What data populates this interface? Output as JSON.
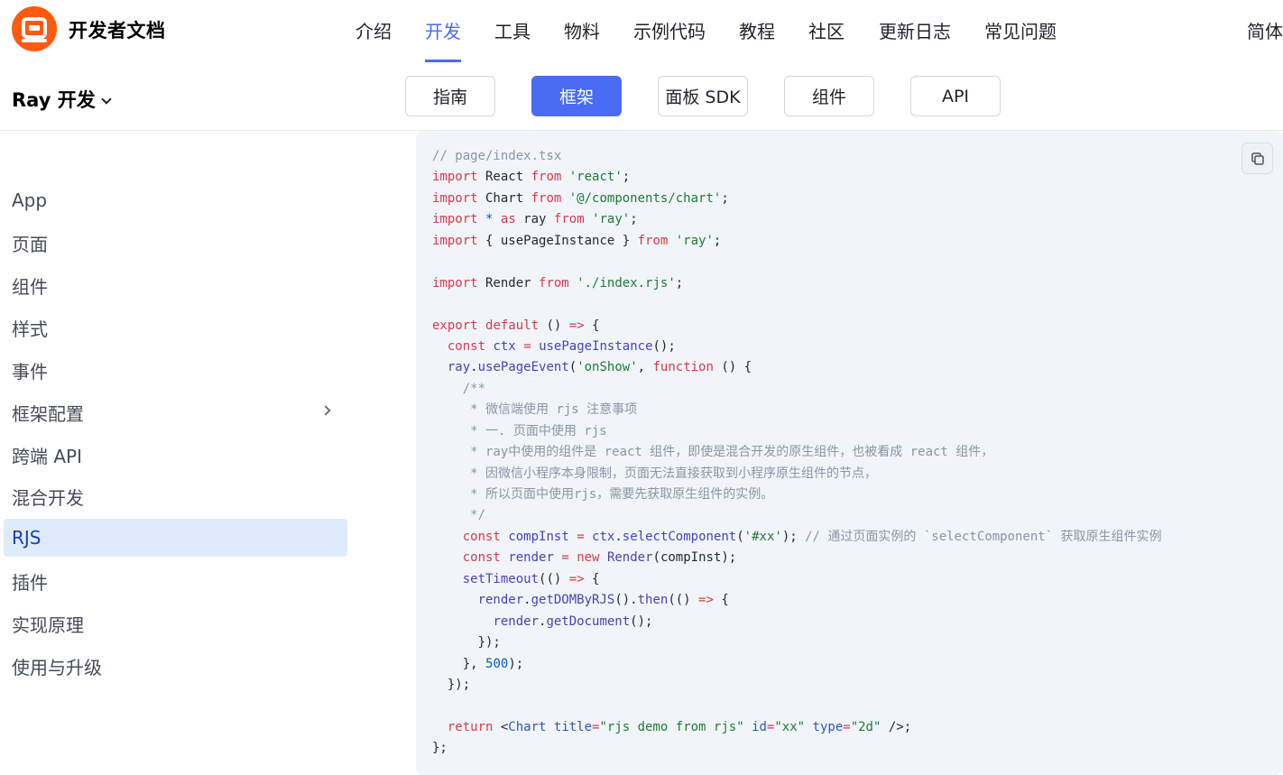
{
  "topbar": {
    "brand": "开发者文档",
    "nav": [
      "介绍",
      "开发",
      "工具",
      "物料",
      "示例代码",
      "教程",
      "社区",
      "更新日志",
      "常见问题"
    ],
    "active_nav": "开发",
    "lang": "简体"
  },
  "subheader": {
    "product": "Ray 开发",
    "tabs": [
      "指南",
      "框架",
      "面板 SDK",
      "组件",
      "API"
    ],
    "active_tab": "框架"
  },
  "sidebar": {
    "items": [
      "App",
      "页面",
      "组件",
      "样式",
      "事件",
      "框架配置",
      "跨端 API",
      "混合开发",
      "RJS",
      "插件",
      "实现原理",
      "使用与升级"
    ],
    "active": "RJS"
  },
  "code": {
    "copy_icon": "copy-icon",
    "lines": [
      [
        [
          "c",
          "// page/index.tsx"
        ]
      ],
      [
        [
          "k",
          "import"
        ],
        [
          "p",
          " React "
        ],
        [
          "k",
          "from"
        ],
        [
          "p",
          " "
        ],
        [
          "s",
          "'react'"
        ],
        [
          "p",
          ";"
        ]
      ],
      [
        [
          "k",
          "import"
        ],
        [
          "p",
          " Chart "
        ],
        [
          "k",
          "from"
        ],
        [
          "p",
          " "
        ],
        [
          "s",
          "'@/components/chart'"
        ],
        [
          "p",
          ";"
        ]
      ],
      [
        [
          "k",
          "import"
        ],
        [
          "p",
          " "
        ],
        [
          "n",
          "*"
        ],
        [
          "p",
          " "
        ],
        [
          "k",
          "as"
        ],
        [
          "p",
          " ray "
        ],
        [
          "k",
          "from"
        ],
        [
          "p",
          " "
        ],
        [
          "s",
          "'ray'"
        ],
        [
          "p",
          ";"
        ]
      ],
      [
        [
          "k",
          "import"
        ],
        [
          "p",
          " { usePageInstance } "
        ],
        [
          "k",
          "from"
        ],
        [
          "p",
          " "
        ],
        [
          "s",
          "'ray'"
        ],
        [
          "p",
          ";"
        ]
      ],
      [],
      [
        [
          "k",
          "import"
        ],
        [
          "p",
          " Render "
        ],
        [
          "k",
          "from"
        ],
        [
          "p",
          " "
        ],
        [
          "s",
          "'./index.rjs'"
        ],
        [
          "p",
          ";"
        ]
      ],
      [],
      [
        [
          "k",
          "export"
        ],
        [
          "p",
          " "
        ],
        [
          "k",
          "default"
        ],
        [
          "p",
          " () "
        ],
        [
          "k",
          "=>"
        ],
        [
          "p",
          " {"
        ]
      ],
      [
        [
          "p",
          "  "
        ],
        [
          "k",
          "const"
        ],
        [
          "p",
          " "
        ],
        [
          "f",
          "ctx"
        ],
        [
          "p",
          " "
        ],
        [
          "k",
          "="
        ],
        [
          "p",
          " "
        ],
        [
          "f",
          "usePageInstance"
        ],
        [
          "p",
          "();"
        ]
      ],
      [
        [
          "p",
          "  "
        ],
        [
          "f",
          "ray"
        ],
        [
          "p",
          "."
        ],
        [
          "f",
          "usePageEvent"
        ],
        [
          "p",
          "("
        ],
        [
          "s",
          "'onShow'"
        ],
        [
          "p",
          ", "
        ],
        [
          "k",
          "function"
        ],
        [
          "p",
          " () {"
        ]
      ],
      [
        [
          "c",
          "    /**"
        ]
      ],
      [
        [
          "c",
          "     * 微信端使用 rjs 注意事项"
        ]
      ],
      [
        [
          "c",
          "     * 一. 页面中使用 rjs"
        ]
      ],
      [
        [
          "c",
          "     * ray中使用的组件是 react 组件，即使是混合开发的原生组件，也被看成 react 组件，"
        ]
      ],
      [
        [
          "c",
          "     * 因微信小程序本身限制，页面无法直接获取到小程序原生组件的节点，"
        ]
      ],
      [
        [
          "c",
          "     * 所以页面中使用rjs，需要先获取原生组件的实例。"
        ]
      ],
      [
        [
          "c",
          "     */"
        ]
      ],
      [
        [
          "p",
          "    "
        ],
        [
          "k",
          "const"
        ],
        [
          "p",
          " "
        ],
        [
          "f",
          "compInst"
        ],
        [
          "p",
          " "
        ],
        [
          "k",
          "="
        ],
        [
          "p",
          " "
        ],
        [
          "f",
          "ctx"
        ],
        [
          "p",
          "."
        ],
        [
          "f",
          "selectComponent"
        ],
        [
          "p",
          "("
        ],
        [
          "s",
          "'#xx'"
        ],
        [
          "p",
          "); "
        ],
        [
          "c",
          "// 通过页面实例的 `selectComponent` 获取原生组件实例"
        ]
      ],
      [
        [
          "p",
          "    "
        ],
        [
          "k",
          "const"
        ],
        [
          "p",
          " "
        ],
        [
          "f",
          "render"
        ],
        [
          "p",
          " "
        ],
        [
          "k",
          "="
        ],
        [
          "p",
          " "
        ],
        [
          "k",
          "new"
        ],
        [
          "p",
          " "
        ],
        [
          "f",
          "Render"
        ],
        [
          "p",
          "(compInst);"
        ]
      ],
      [
        [
          "p",
          "    "
        ],
        [
          "f",
          "setTimeout"
        ],
        [
          "p",
          "(() "
        ],
        [
          "k",
          "=>"
        ],
        [
          "p",
          " {"
        ]
      ],
      [
        [
          "p",
          "      "
        ],
        [
          "f",
          "render"
        ],
        [
          "p",
          "."
        ],
        [
          "f",
          "getDOMByRJS"
        ],
        [
          "p",
          "()."
        ],
        [
          "f",
          "then"
        ],
        [
          "p",
          "(() "
        ],
        [
          "k",
          "=>"
        ],
        [
          "p",
          " {"
        ]
      ],
      [
        [
          "p",
          "        "
        ],
        [
          "f",
          "render"
        ],
        [
          "p",
          "."
        ],
        [
          "f",
          "getDocument"
        ],
        [
          "p",
          "();"
        ]
      ],
      [
        [
          "p",
          "      });"
        ]
      ],
      [
        [
          "p",
          "    }, "
        ],
        [
          "n",
          "500"
        ],
        [
          "p",
          ");"
        ]
      ],
      [
        [
          "p",
          "  });"
        ]
      ],
      [],
      [
        [
          "p",
          "  "
        ],
        [
          "k",
          "return"
        ],
        [
          "p",
          " <"
        ],
        [
          "t",
          "Chart"
        ],
        [
          "p",
          " "
        ],
        [
          "t",
          "title"
        ],
        [
          "k",
          "="
        ],
        [
          "s",
          "\"rjs demo from rjs\""
        ],
        [
          "p",
          " "
        ],
        [
          "t",
          "id"
        ],
        [
          "k",
          "="
        ],
        [
          "s",
          "\"xx\""
        ],
        [
          "p",
          " "
        ],
        [
          "t",
          "type"
        ],
        [
          "k",
          "="
        ],
        [
          "s",
          "\"2d\""
        ],
        [
          "p",
          " />;"
        ]
      ],
      [
        [
          "p",
          "};"
        ]
      ]
    ]
  }
}
